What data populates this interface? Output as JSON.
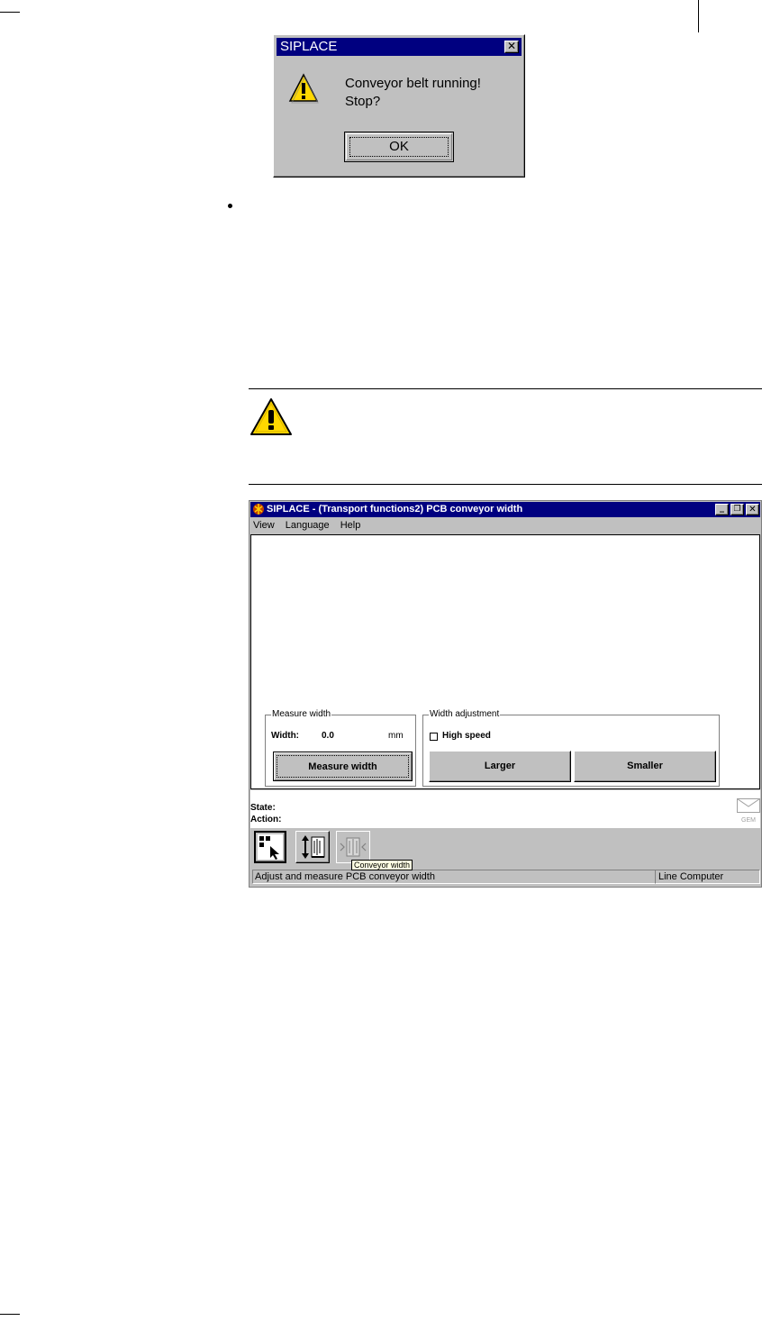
{
  "dialog": {
    "title": "SIPLACE",
    "message_line1": "Conveyor belt running!",
    "message_line2": "Stop?",
    "ok_label": "OK",
    "close_glyph": "✕",
    "icon": "warning-icon"
  },
  "caution_icon": "warning-icon",
  "app": {
    "title": "SIPLACE - (Transport functions2) PCB conveyor width",
    "menu": [
      "View",
      "Language",
      "Help"
    ],
    "minimize_glyph": "_",
    "restore_glyph": "❐",
    "close_glyph": "✕",
    "measure_group": {
      "label": "Measure width",
      "width_label": "Width:",
      "width_value": "0.0",
      "unit": "mm",
      "button_label": "Measure width"
    },
    "adjust_group": {
      "label": "Width adjustment",
      "high_speed_label": "High speed",
      "high_speed_checked": false,
      "larger_label": "Larger",
      "smaller_label": "Smaller"
    },
    "state_label": "State:",
    "action_label": "Action:",
    "gem_label": "GEM",
    "tooltip": "Conveyor width",
    "status_text": "Adjust and measure PCB conveyor width",
    "status_right": "Line Computer"
  },
  "colors": {
    "titlebar": "#000080",
    "face": "#c0c0c0",
    "warning_yellow": "#ffd800"
  }
}
